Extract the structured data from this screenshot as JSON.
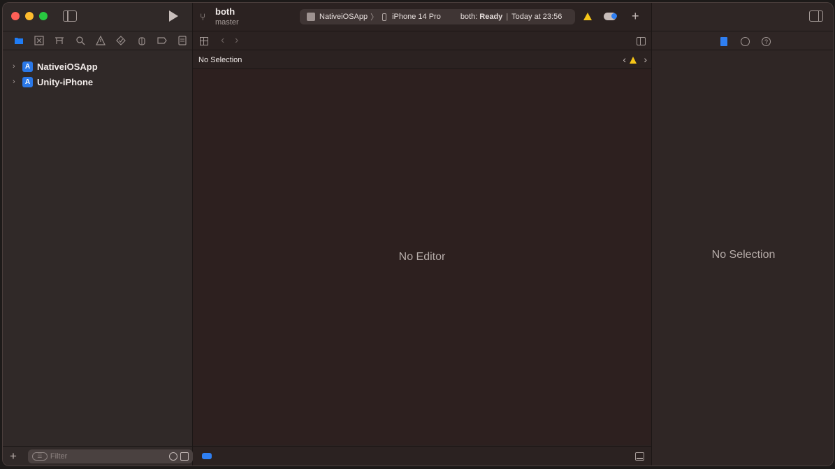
{
  "toolbar": {
    "scheme_name": "both",
    "branch_name": "master",
    "target_app": "NativeiOSApp",
    "breadcrumb_sep": "〉",
    "device": "iPhone 14 Pro",
    "status_prefix": "both:",
    "status_ready": "Ready",
    "status_sep": "|",
    "status_time": "Today at 23:56",
    "plus_label": "+"
  },
  "navigator": {
    "tabs": [
      "project",
      "source-control",
      "symbols",
      "find",
      "issues",
      "tests",
      "debug",
      "breakpoints",
      "reports"
    ],
    "items": [
      {
        "label": "NativeiOSApp",
        "chevron": "›"
      },
      {
        "label": "Unity-iPhone",
        "chevron": "›"
      }
    ],
    "add_label": "+",
    "filter_placeholder": "Filter",
    "filter_icon_glyph": "☰"
  },
  "editor": {
    "jump_label": "No Selection",
    "back_glyph": "‹",
    "forward_glyph": "›",
    "placeholder": "No Editor"
  },
  "inspector": {
    "placeholder": "No Selection",
    "help_glyph": "?"
  },
  "colors": {
    "accent": "#2f7ff2",
    "warning": "#f5c518",
    "close": "#fe5f57",
    "minimize": "#febc2e",
    "maximize": "#28c840"
  }
}
